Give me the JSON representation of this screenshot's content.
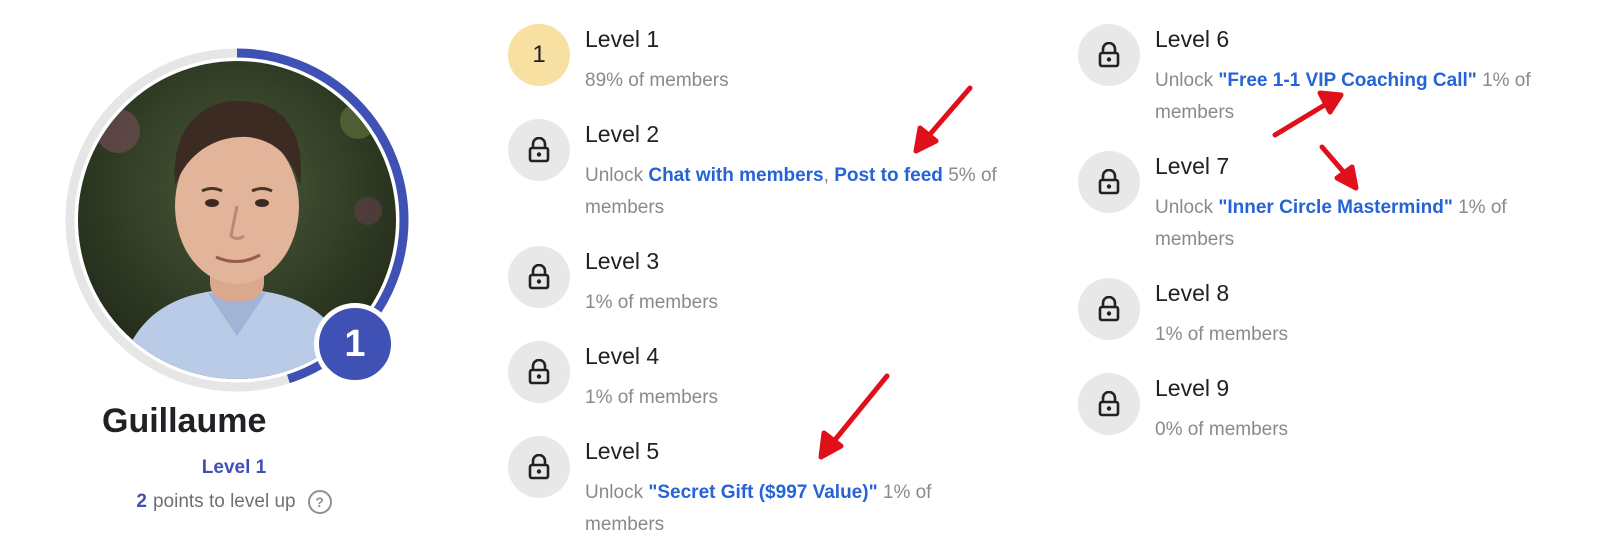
{
  "profile": {
    "name": "Guillaume",
    "level_label": "Level 1",
    "badge_number": "1",
    "points_value": "2",
    "points_suffix": "points to level up",
    "help_glyph": "?",
    "progress_fraction": 0.45
  },
  "levels": [
    {
      "number": "1",
      "title": "Level 1",
      "members_pct": "89% of members",
      "current": true
    },
    {
      "title": "Level 2",
      "unlock_prefix": "Unlock",
      "unlocks": [
        "Chat with members",
        "Post to feed"
      ],
      "separator": ",",
      "members_pct": "5% of members",
      "icon": "lock-icon"
    },
    {
      "title": "Level 3",
      "members_pct": "1% of members",
      "icon": "lock-icon"
    },
    {
      "title": "Level 4",
      "members_pct": "1% of members",
      "icon": "lock-icon"
    },
    {
      "title": "Level 5",
      "unlock_prefix": "Unlock",
      "unlocks": [
        "\"Secret Gift ($997 Value)\""
      ],
      "members_pct": "1% of members",
      "icon": "lock-icon"
    },
    {
      "title": "Level 6",
      "unlock_prefix": "Unlock",
      "unlocks": [
        "\"Free 1-1 VIP Coaching Call\""
      ],
      "members_pct": "1% of members",
      "icon": "lock-icon"
    },
    {
      "title": "Level 7",
      "unlock_prefix": "Unlock",
      "unlocks": [
        "\"Inner Circle Mastermind\""
      ],
      "members_pct": "1% of members",
      "icon": "lock-icon"
    },
    {
      "title": "Level 8",
      "members_pct": "1% of members",
      "icon": "lock-icon"
    },
    {
      "title": "Level 9",
      "members_pct": "0% of members",
      "icon": "lock-icon"
    }
  ],
  "colors": {
    "accent": "#3f51b5",
    "link": "#2563d6",
    "current_level_bg": "#f8dfa2",
    "locked_bg": "#e8e8e8",
    "muted_text": "#8a8a8a",
    "annotation_arrow": "#e0101a"
  }
}
